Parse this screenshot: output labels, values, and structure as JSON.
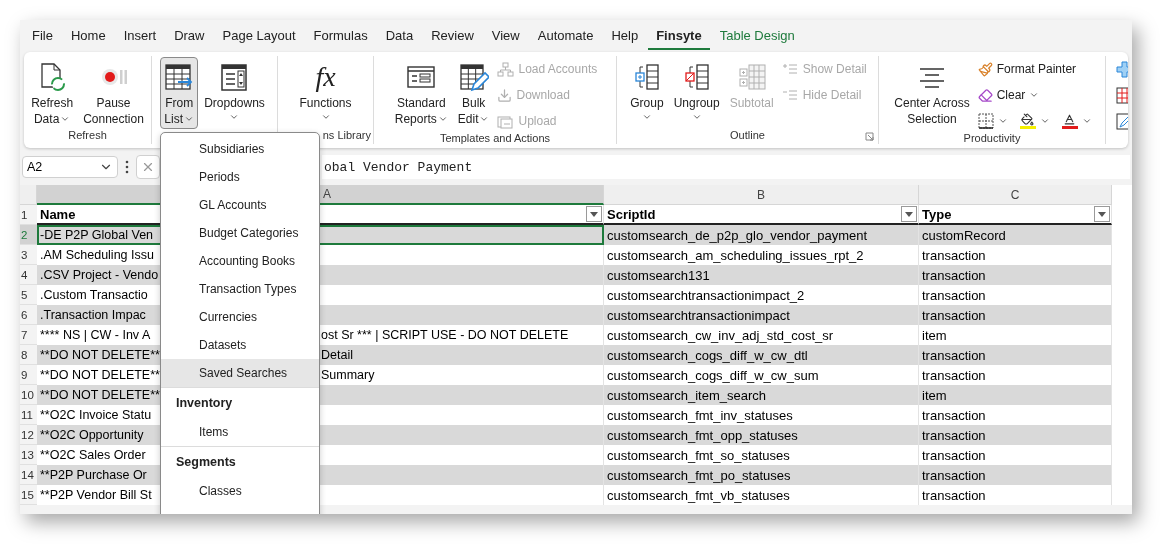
{
  "menu_tabs": [
    {
      "label": "File",
      "selected": false,
      "contextual": false
    },
    {
      "label": "Home",
      "selected": false,
      "contextual": false
    },
    {
      "label": "Insert",
      "selected": false,
      "contextual": false
    },
    {
      "label": "Draw",
      "selected": false,
      "contextual": false
    },
    {
      "label": "Page Layout",
      "selected": false,
      "contextual": false
    },
    {
      "label": "Formulas",
      "selected": false,
      "contextual": false
    },
    {
      "label": "Data",
      "selected": false,
      "contextual": false
    },
    {
      "label": "Review",
      "selected": false,
      "contextual": false
    },
    {
      "label": "View",
      "selected": false,
      "contextual": false
    },
    {
      "label": "Automate",
      "selected": false,
      "contextual": false
    },
    {
      "label": "Help",
      "selected": false,
      "contextual": false
    },
    {
      "label": "Finsyte",
      "selected": true,
      "contextual": false
    },
    {
      "label": "Table Design",
      "selected": false,
      "contextual": true
    }
  ],
  "ribbon_groups": [
    {
      "label": "Refresh",
      "items": [
        {
          "kind": "large",
          "lines": [
            "Refresh",
            "Data"
          ],
          "caret": true,
          "pressed": false,
          "disabled": false
        },
        {
          "kind": "large",
          "lines": [
            "Pause",
            "Connection"
          ],
          "caret": false,
          "pressed": false,
          "disabled": false
        }
      ]
    },
    {
      "items": [
        {
          "kind": "large",
          "lines": [
            "From",
            "List"
          ],
          "caret": true,
          "pressed": true,
          "disabled": false
        },
        {
          "kind": "large",
          "lines": [
            "Dropdowns"
          ],
          "caret": true,
          "pressed": false,
          "disabled": false
        }
      ]
    },
    {
      "label": "ns Library",
      "items": [
        {
          "kind": "large",
          "glyph": "fx",
          "lines": [
            "Functions"
          ],
          "caret": true,
          "pressed": false,
          "disabled": false
        }
      ]
    },
    {
      "label": "Templates and Actions",
      "items": [
        {
          "kind": "large",
          "lines": [
            "Standard",
            "Reports"
          ],
          "caret": true,
          "pressed": false,
          "disabled": false
        },
        {
          "kind": "large",
          "lines": [
            "Bulk",
            "Edit"
          ],
          "caret": true,
          "pressed": false,
          "disabled": false
        },
        {
          "kind": "column",
          "entries": [
            {
              "kind": "text",
              "label": "Load Accounts",
              "caret": false,
              "disabled": true
            },
            {
              "kind": "text",
              "label": "Download",
              "caret": false,
              "disabled": true
            },
            {
              "kind": "text",
              "label": "Upload",
              "caret": false,
              "disabled": true
            }
          ]
        }
      ]
    },
    {
      "label": "Outline",
      "launcher": true,
      "items": [
        {
          "kind": "large",
          "lines": [
            "Group"
          ],
          "caret": true,
          "pressed": false,
          "disabled": false
        },
        {
          "kind": "large",
          "lines": [
            "Ungroup"
          ],
          "caret": true,
          "pressed": false,
          "disabled": false
        },
        {
          "kind": "large",
          "lines": [
            "Subtotal"
          ],
          "caret": false,
          "pressed": false,
          "disabled": true
        },
        {
          "kind": "column",
          "entries": [
            {
              "kind": "text",
              "label": "Show Detail",
              "caret": false,
              "disabled": true
            },
            {
              "kind": "text",
              "label": "Hide Detail",
              "caret": false,
              "disabled": true
            }
          ]
        }
      ]
    },
    {
      "label": "Productivity",
      "items": [
        {
          "kind": "large",
          "lines": [
            "Center Across",
            "Selection"
          ],
          "caret": false,
          "pressed": false,
          "disabled": false
        },
        {
          "kind": "column",
          "entries": [
            {
              "kind": "text",
              "label": "Format Painter",
              "caret": false,
              "disabled": false
            },
            {
              "kind": "text",
              "label": "Clear",
              "caret": true,
              "disabled": false
            },
            {
              "kind": "icons",
              "icons": [
                {
                  "caret": true
                },
                {
                  "caret": true
                },
                {
                  "caret": true
                }
              ]
            }
          ]
        }
      ]
    },
    {
      "items": [
        {
          "kind": "column",
          "entries": [
            {
              "kind": "icon",
              "caret": false,
              "disabled": false
            },
            {
              "kind": "icon",
              "caret": false,
              "disabled": false
            },
            {
              "kind": "icon",
              "caret": false,
              "disabled": false
            }
          ]
        }
      ]
    }
  ],
  "formula_bar": {
    "name_box": "A2",
    "formula": "obal Vendor Payment"
  },
  "sheet": {
    "column_letters": [
      {
        "label": "A",
        "selected": true
      },
      {
        "label": "B",
        "selected": false
      },
      {
        "label": "C",
        "selected": false
      }
    ],
    "header_row_number": "1",
    "headers": [
      "Name",
      "ScriptId",
      "Type"
    ],
    "rows": [
      {
        "number": "2",
        "name": "-DE P2P Global Ven",
        "name_tail": "",
        "script_id": "customsearch_de_p2p_glo_vendor_payment",
        "type": "customRecord",
        "selected": true
      },
      {
        "number": "3",
        "name": ".AM Scheduling Issu",
        "name_tail": "",
        "script_id": "customsearch_am_scheduling_issues_rpt_2",
        "type": "transaction",
        "selected": false
      },
      {
        "number": "4",
        "name": ".CSV Project - Vendo",
        "name_tail": "",
        "script_id": "customsearch131",
        "type": "transaction",
        "selected": false
      },
      {
        "number": "5",
        "name": ".Custom Transactio",
        "name_tail": "",
        "script_id": "customsearchtransactionimpact_2",
        "type": "transaction",
        "selected": false
      },
      {
        "number": "6",
        "name": ".Transaction Impac",
        "name_tail": "",
        "script_id": "customsearchtransactionimpact",
        "type": "transaction",
        "selected": false
      },
      {
        "number": "7",
        "name": "**** NS | CW - Inv A",
        "name_tail": "ost Sr *** | SCRIPT USE - DO NOT DELETE",
        "script_id": "customsearch_cw_inv_adj_std_cost_sr",
        "type": "item",
        "selected": false
      },
      {
        "number": "8",
        "name": "**DO NOT DELETE**",
        "name_tail": "Detail",
        "script_id": "customsearch_cogs_diff_w_cw_dtl",
        "type": "transaction",
        "selected": false
      },
      {
        "number": "9",
        "name": "**DO NOT DELETE**",
        "name_tail": "Summary",
        "script_id": "customsearch_cogs_diff_w_cw_sum",
        "type": "transaction",
        "selected": false
      },
      {
        "number": "10",
        "name": "**DO NOT DELETE**",
        "name_tail": "",
        "script_id": "customsearch_item_search",
        "type": "item",
        "selected": false
      },
      {
        "number": "11",
        "name": "**O2C Invoice Statu",
        "name_tail": "",
        "script_id": "customsearch_fmt_inv_statuses",
        "type": "transaction",
        "selected": false
      },
      {
        "number": "12",
        "name": "**O2C Opportunity",
        "name_tail": "",
        "script_id": "customsearch_fmt_opp_statuses",
        "type": "transaction",
        "selected": false
      },
      {
        "number": "13",
        "name": "**O2C Sales Order",
        "name_tail": "",
        "script_id": "customsearch_fmt_so_statuses",
        "type": "transaction",
        "selected": false
      },
      {
        "number": "14",
        "name": "**P2P Purchase Or",
        "name_tail": "",
        "script_id": "customsearch_fmt_po_statuses",
        "type": "transaction",
        "selected": false
      },
      {
        "number": "15",
        "name": "**P2P Vendor Bill St",
        "name_tail": "",
        "script_id": "customsearch_fmt_vb_statuses",
        "type": "transaction",
        "selected": false
      }
    ]
  },
  "dropdown_menu": {
    "items": [
      {
        "kind": "item",
        "label": "Subsidiaries",
        "highlighted": false
      },
      {
        "kind": "item",
        "label": "Periods",
        "highlighted": false
      },
      {
        "kind": "item",
        "label": "GL Accounts",
        "highlighted": false
      },
      {
        "kind": "item",
        "label": "Budget Categories",
        "highlighted": false
      },
      {
        "kind": "item",
        "label": "Accounting Books",
        "highlighted": false
      },
      {
        "kind": "item",
        "label": "Transaction Types",
        "highlighted": false
      },
      {
        "kind": "item",
        "label": "Currencies",
        "highlighted": false
      },
      {
        "kind": "item",
        "label": "Datasets",
        "highlighted": false
      },
      {
        "kind": "item",
        "label": "Saved Searches",
        "highlighted": true
      },
      {
        "kind": "header",
        "label": "Inventory"
      },
      {
        "kind": "item",
        "label": "Items",
        "highlighted": false
      },
      {
        "kind": "header",
        "label": "Segments"
      },
      {
        "kind": "item",
        "label": "Classes",
        "highlighted": false
      }
    ]
  }
}
